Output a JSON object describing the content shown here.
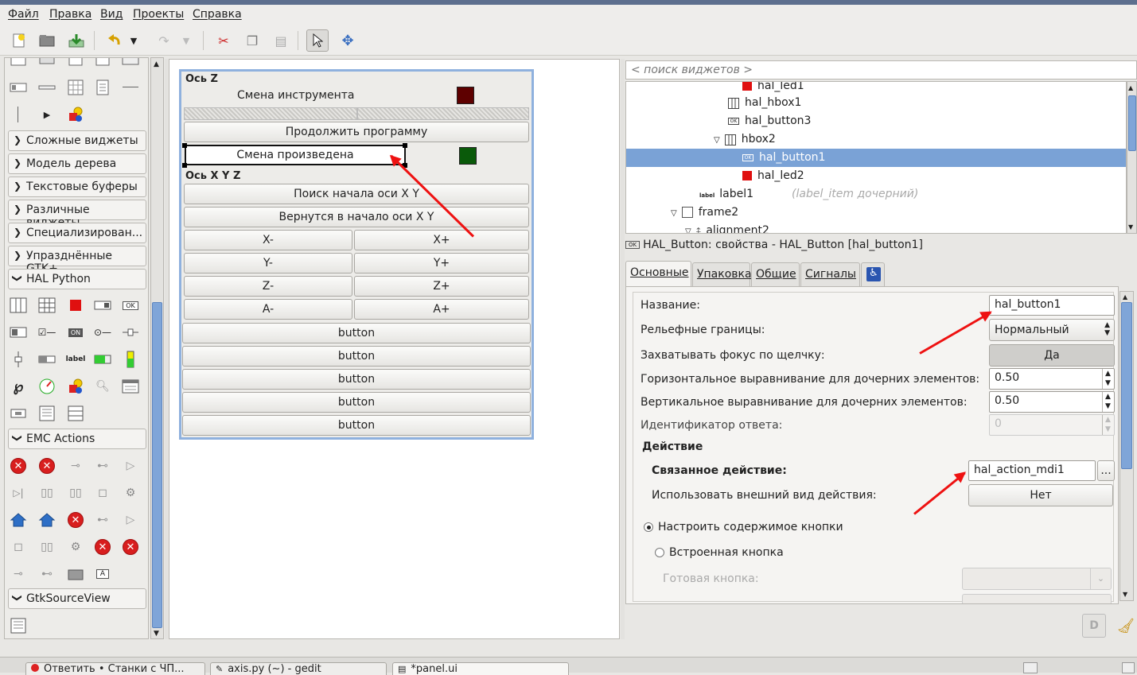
{
  "menu": [
    "Файл",
    "Правка",
    "Вид",
    "Проекты",
    "Справка"
  ],
  "palette": {
    "groups": [
      "Сложные виджеты",
      "Модель дерева",
      "Текстовые буферы",
      "Различные виджеты",
      "Специализирован...",
      "Упразднённые GTK+",
      "HAL Python",
      "EMC Actions",
      "GtkSourceView"
    ],
    "icon_label": "label",
    "ok_label": "OK",
    "on_label": "ON"
  },
  "design": {
    "axis_z_label": "Ось Z",
    "tool_change": "Смена инструмента",
    "continue_program": "Продолжить программу",
    "change_done": "Смена произведена",
    "axis_xyz_label": "Ось X Y Z",
    "home_search": "Поиск начала оси X Y",
    "return_home": "Вернутся в начало оси X Y",
    "jog": [
      "X-",
      "X+",
      "Y-",
      "Y+",
      "Z-",
      "Z+",
      "A-",
      "A+"
    ],
    "buttons": [
      "button",
      "button",
      "button",
      "button",
      "button"
    ],
    "colors": {
      "led_red": "#5e0000",
      "led_green": "#0a5a0a"
    }
  },
  "search": {
    "placeholder": "< поиск виджетов >"
  },
  "tree": {
    "items": [
      {
        "label": "hal_led1"
      },
      {
        "label": "hal_hbox1"
      },
      {
        "label": "hal_button3"
      },
      {
        "label": "hbox2"
      },
      {
        "label": "hal_button1"
      },
      {
        "label": "hal_led2"
      },
      {
        "label": "label1",
        "note": "(label_item дочерний)"
      },
      {
        "label": "frame2"
      },
      {
        "label": "alignment2"
      }
    ],
    "ok_icon": "OK",
    "label_icon": "label"
  },
  "props": {
    "title": "HAL_Button: свойства - HAL_Button [hal_button1]",
    "title_icon": "OK",
    "tabs": [
      "Основные",
      "Упаковка",
      "Общие",
      "Сигналы"
    ],
    "rows": {
      "name_label": "Название:",
      "name_value": "hal_button1",
      "relief_label": "Рельефные границы:",
      "relief_value": "Нормальный",
      "focus_label": "Захватывать фокус по щелчку:",
      "focus_value": "Да",
      "halign_label": "Горизонтальное выравнивание для дочерних элементов:",
      "halign_value": "0.50",
      "valign_label": "Вертикальное выравнивание для дочерних элементов:",
      "valign_value": "0.50",
      "response_label": "Идентификатор ответа:",
      "response_value": "0",
      "action_header": "Действие",
      "related_label": "Связанное действие:",
      "related_value": "hal_action_mdi1",
      "related_btn": "...",
      "appearance_label": "Использовать внешний вид действия:",
      "appearance_value": "Нет",
      "radio_custom": "Настроить содержимое кнопки",
      "radio_builtin": "Встроенная кнопка",
      "stock_label": "Готовая кнопка:"
    }
  },
  "taskbar": [
    "Ответить • Станки с ЧП...",
    "axis.py (~) - gedit",
    "*panel.ui"
  ]
}
